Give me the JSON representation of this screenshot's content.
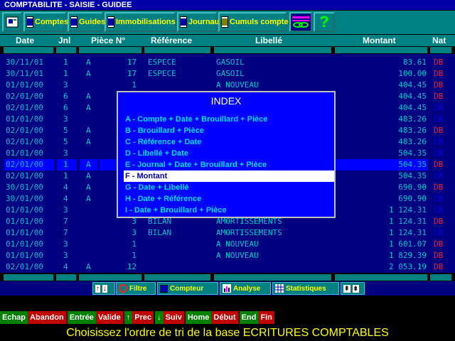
{
  "title": "COMPTABILITE - SAISIE - GUIDEE",
  "toolbar": {
    "items": [
      {
        "label": "Comptes",
        "icon": "book-icon"
      },
      {
        "label": "Guides",
        "icon": "book-icon"
      },
      {
        "label": "Immobilisations",
        "icon": "book-icon"
      },
      {
        "label": "Journaux",
        "icon": "book-icon"
      },
      {
        "label": "Cumuls compte",
        "icon": "sum-icon"
      }
    ],
    "help_symbol": "?"
  },
  "columns": [
    "Date",
    "Jnl",
    "Pièce N°",
    "Référence",
    "Libellé",
    "Montant",
    "Nat"
  ],
  "rows": [
    {
      "date": "30/11/01",
      "jnl": "1",
      "piece_type": "A",
      "piece": "17",
      "ref": "ESPECE",
      "libelle": "GASOIL",
      "montant": "83.61",
      "nat": "DB"
    },
    {
      "date": "30/11/01",
      "jnl": "1",
      "piece_type": "A",
      "piece": "17",
      "ref": "ESPECE",
      "libelle": "GASOIL",
      "montant": "100.00",
      "nat": "DB"
    },
    {
      "date": "01/01/00",
      "jnl": "3",
      "piece_type": "",
      "piece": "1",
      "ref": "",
      "libelle": "A NOUVEAU",
      "montant": "404.45",
      "nat": "DB"
    },
    {
      "date": "02/01/00",
      "jnl": "6",
      "piece_type": "A",
      "piece": "",
      "ref": "",
      "libelle": "",
      "montant": "404.45",
      "nat": "DB"
    },
    {
      "date": "02/01/00",
      "jnl": "6",
      "piece_type": "A",
      "piece": "",
      "ref": "",
      "libelle": "",
      "montant": "404.45",
      "nat": "CR"
    },
    {
      "date": "01/01/00",
      "jnl": "3",
      "piece_type": "",
      "piece": "",
      "ref": "",
      "libelle": "",
      "montant": "483.26",
      "nat": "CR"
    },
    {
      "date": "02/01/00",
      "jnl": "5",
      "piece_type": "A",
      "piece": "",
      "ref": "",
      "libelle": "",
      "montant": "483.26",
      "nat": "DB"
    },
    {
      "date": "02/01/00",
      "jnl": "5",
      "piece_type": "A",
      "piece": "",
      "ref": "",
      "libelle": "",
      "montant": "483.26",
      "nat": "CR"
    },
    {
      "date": "01/01/00",
      "jnl": "3",
      "piece_type": "",
      "piece": "",
      "ref": "",
      "libelle": "",
      "montant": "504.35",
      "nat": "CR"
    },
    {
      "date": "02/01/00",
      "jnl": "1",
      "piece_type": "A",
      "piece": "",
      "ref": "",
      "libelle": "",
      "montant": "504.35",
      "nat": "DB"
    },
    {
      "date": "02/01/00",
      "jnl": "1",
      "piece_type": "A",
      "piece": "",
      "ref": "",
      "libelle": "",
      "montant": "504.35",
      "nat": "CR"
    },
    {
      "date": "30/01/00",
      "jnl": "4",
      "piece_type": "A",
      "piece": "",
      "ref": "",
      "libelle": "",
      "montant": "690.90",
      "nat": "DB"
    },
    {
      "date": "30/01/00",
      "jnl": "4",
      "piece_type": "A",
      "piece": "",
      "ref": "",
      "libelle": "",
      "montant": "690.90",
      "nat": "CR"
    },
    {
      "date": "01/01/00",
      "jnl": "3",
      "piece_type": "",
      "piece": "",
      "ref": "",
      "libelle": "",
      "montant": "1 124.31",
      "nat": "CR"
    },
    {
      "date": "01/01/00",
      "jnl": "7",
      "piece_type": "",
      "piece": "3",
      "ref": "BILAN",
      "libelle": "AMORTISSEMENTS",
      "montant": "1 124.31",
      "nat": "DB"
    },
    {
      "date": "01/01/00",
      "jnl": "7",
      "piece_type": "",
      "piece": "3",
      "ref": "BILAN",
      "libelle": "AMORTISSEMENTS",
      "montant": "1 124.31",
      "nat": "CR"
    },
    {
      "date": "01/01/00",
      "jnl": "3",
      "piece_type": "",
      "piece": "1",
      "ref": "",
      "libelle": "A NOUVEAU",
      "montant": "1 601.07",
      "nat": "DB"
    },
    {
      "date": "01/01/00",
      "jnl": "3",
      "piece_type": "",
      "piece": "1",
      "ref": "",
      "libelle": "A NOUVEAU",
      "montant": "1 829.39",
      "nat": "DB"
    },
    {
      "date": "02/01/00",
      "jnl": "4",
      "piece_type": "A",
      "piece": "12",
      "ref": "",
      "libelle": "",
      "montant": "2 053.19",
      "nat": "DB"
    }
  ],
  "selected_row": 9,
  "index_popup": {
    "title": "INDEX",
    "options": [
      "A - Compte + Date + Brouillard + Pièce",
      "B - Brouillard + Pièce",
      "C - Référence + Date",
      "D - Libellé + Date",
      "E - Journal + Date + Brouillard + Pièce",
      "F - Montant",
      "G - Date + Libellé",
      "H - Date + Référence",
      "I - Date + Brouillard + Pièce"
    ],
    "selected": 5
  },
  "bottom_toolbar": {
    "filtre": "Filtre",
    "compteur": "Compteur",
    "analyse": "Analyse",
    "statistiques": "Statistiques"
  },
  "keys": [
    {
      "key": "Echap",
      "desc": "Abandon"
    },
    {
      "key": "Entrée",
      "desc": "Valide"
    },
    {
      "key": "↑",
      "desc": "Prec"
    },
    {
      "key": "↓",
      "desc": "Suiv"
    },
    {
      "key": "Home",
      "desc": "Début"
    },
    {
      "key": "End",
      "desc": "Fin"
    }
  ],
  "status": "Choisissez l'ordre de tri de la base ECRITURES COMPTABLES",
  "colors": {
    "db": "#ff2020",
    "cr": "#0000ff",
    "accent": "#008080",
    "text": "#00c8c8"
  }
}
